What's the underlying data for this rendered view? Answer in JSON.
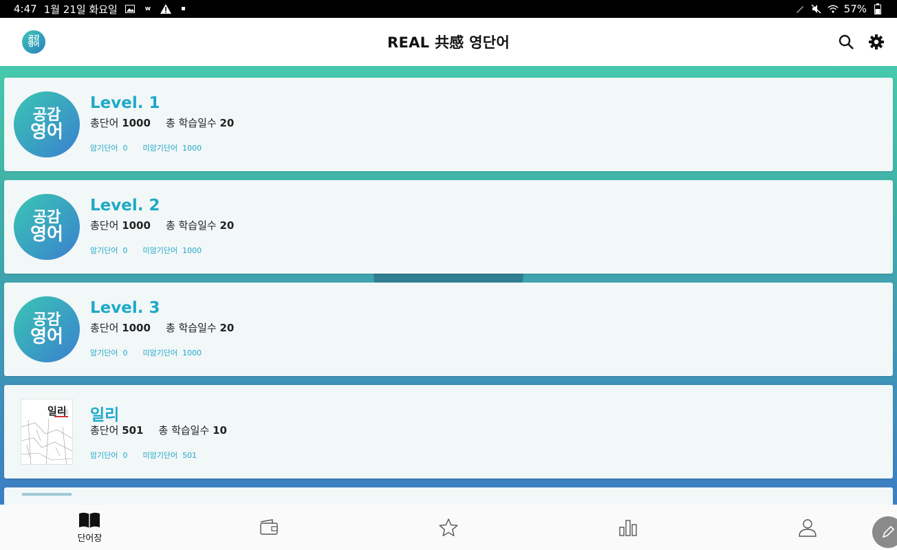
{
  "status_bar": {
    "time": "4:47",
    "date": "1월 21일 화요일",
    "battery": "57%"
  },
  "header": {
    "title": "REAL 共感 영단어",
    "logo_text_top": "공감",
    "logo_text_bottom": "영어"
  },
  "cards": [
    {
      "title": "Level. 1",
      "total_words_label": "총단어",
      "total_words": "1000",
      "total_days_label": "총 학습일수",
      "total_days": "20",
      "memorized_label": "암기단어",
      "memorized": "0",
      "unmemorized_label": "미암기단어",
      "unmemorized": "1000"
    },
    {
      "title": "Level. 2",
      "total_words_label": "총단어",
      "total_words": "1000",
      "total_days_label": "총 학습일수",
      "total_days": "20",
      "memorized_label": "암기단어",
      "memorized": "0",
      "unmemorized_label": "미암기단어",
      "unmemorized": "1000"
    },
    {
      "title": "Level. 3",
      "total_words_label": "총단어",
      "total_words": "1000",
      "total_days_label": "총 학습일수",
      "total_days": "20",
      "memorized_label": "암기단어",
      "memorized": "0",
      "unmemorized_label": "미암기단어",
      "unmemorized": "1000"
    },
    {
      "title": "일리",
      "thumb_title": "일리",
      "total_words_label": "총단어",
      "total_words": "501",
      "total_days_label": "총 학습일수",
      "total_days": "10",
      "memorized_label": "암기단어",
      "memorized": "0",
      "unmemorized_label": "미암기단어",
      "unmemorized": "501"
    }
  ],
  "bottom_nav": [
    {
      "label": "단어장",
      "icon": "book-open-icon",
      "active": true
    },
    {
      "label": "",
      "icon": "wallet-icon",
      "active": false
    },
    {
      "label": "",
      "icon": "star-icon",
      "active": false
    },
    {
      "label": "",
      "icon": "bar-chart-icon",
      "active": false
    },
    {
      "label": "",
      "icon": "person-icon",
      "active": false
    }
  ],
  "colors": {
    "accent": "#1fa9c8",
    "gradient_top": "#45c9ab",
    "gradient_bottom": "#3c7dc4"
  }
}
